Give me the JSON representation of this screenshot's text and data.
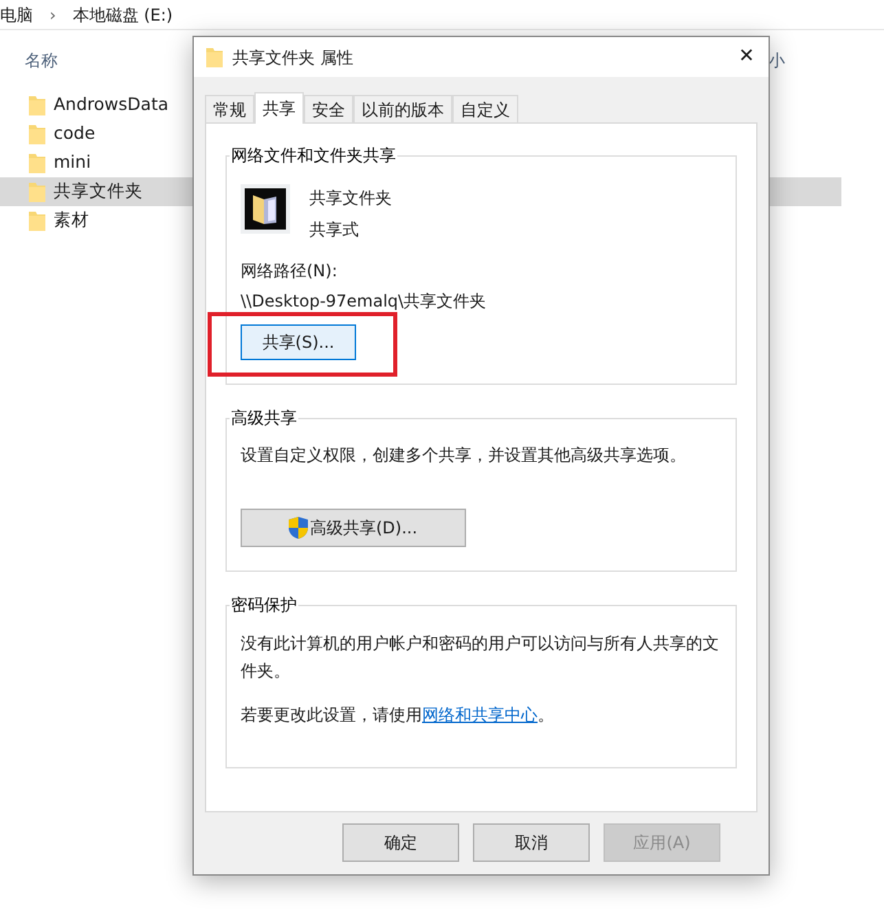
{
  "explorer": {
    "breadcrumb": [
      {
        "label": "电脑"
      },
      {
        "label": "本地磁盘 (E:)"
      }
    ],
    "separator": "›",
    "columns": [
      {
        "label": "名称"
      },
      {
        "label": "小"
      }
    ],
    "files": [
      {
        "name": "AndrowsData",
        "selected": false
      },
      {
        "name": "code",
        "selected": false
      },
      {
        "name": "mini",
        "selected": false
      },
      {
        "name": "共享文件夹",
        "selected": true
      },
      {
        "name": "素材",
        "selected": false
      }
    ]
  },
  "dialog": {
    "title": "共享文件夹 属性",
    "close": "✕",
    "tabs": [
      {
        "label": "常规",
        "selected": false
      },
      {
        "label": "共享",
        "selected": true
      },
      {
        "label": "安全",
        "selected": false
      },
      {
        "label": "以前的版本",
        "selected": false
      },
      {
        "label": "自定义",
        "selected": false
      }
    ],
    "network_sharing": {
      "title": "网络文件和文件夹共享",
      "folder_name": "共享文件夹",
      "share_state": "共享式",
      "path_label": "网络路径(N):",
      "path": "\\\\Desktop-97emalq\\共享文件夹",
      "button": {
        "label": "共享(S)...",
        "highlighted": true
      }
    },
    "advanced_sharing": {
      "title": "高级共享",
      "description": "设置自定义权限，创建多个共享，并设置其他高级共享选项。",
      "button": {
        "label": "高级共享(D)..."
      }
    },
    "password_protection": {
      "title": "密码保护",
      "description": "没有此计算机的用户帐户和密码的用户可以访问与所有人共享的文件夹。",
      "hint": "若要更改此设置，请使用",
      "link": "网络和共享中心",
      "hint_end": "。"
    },
    "buttons": [
      {
        "label": "确定",
        "disabled": false
      },
      {
        "label": "取消",
        "disabled": false
      },
      {
        "label": "应用(A)",
        "disabled": true
      }
    ]
  }
}
